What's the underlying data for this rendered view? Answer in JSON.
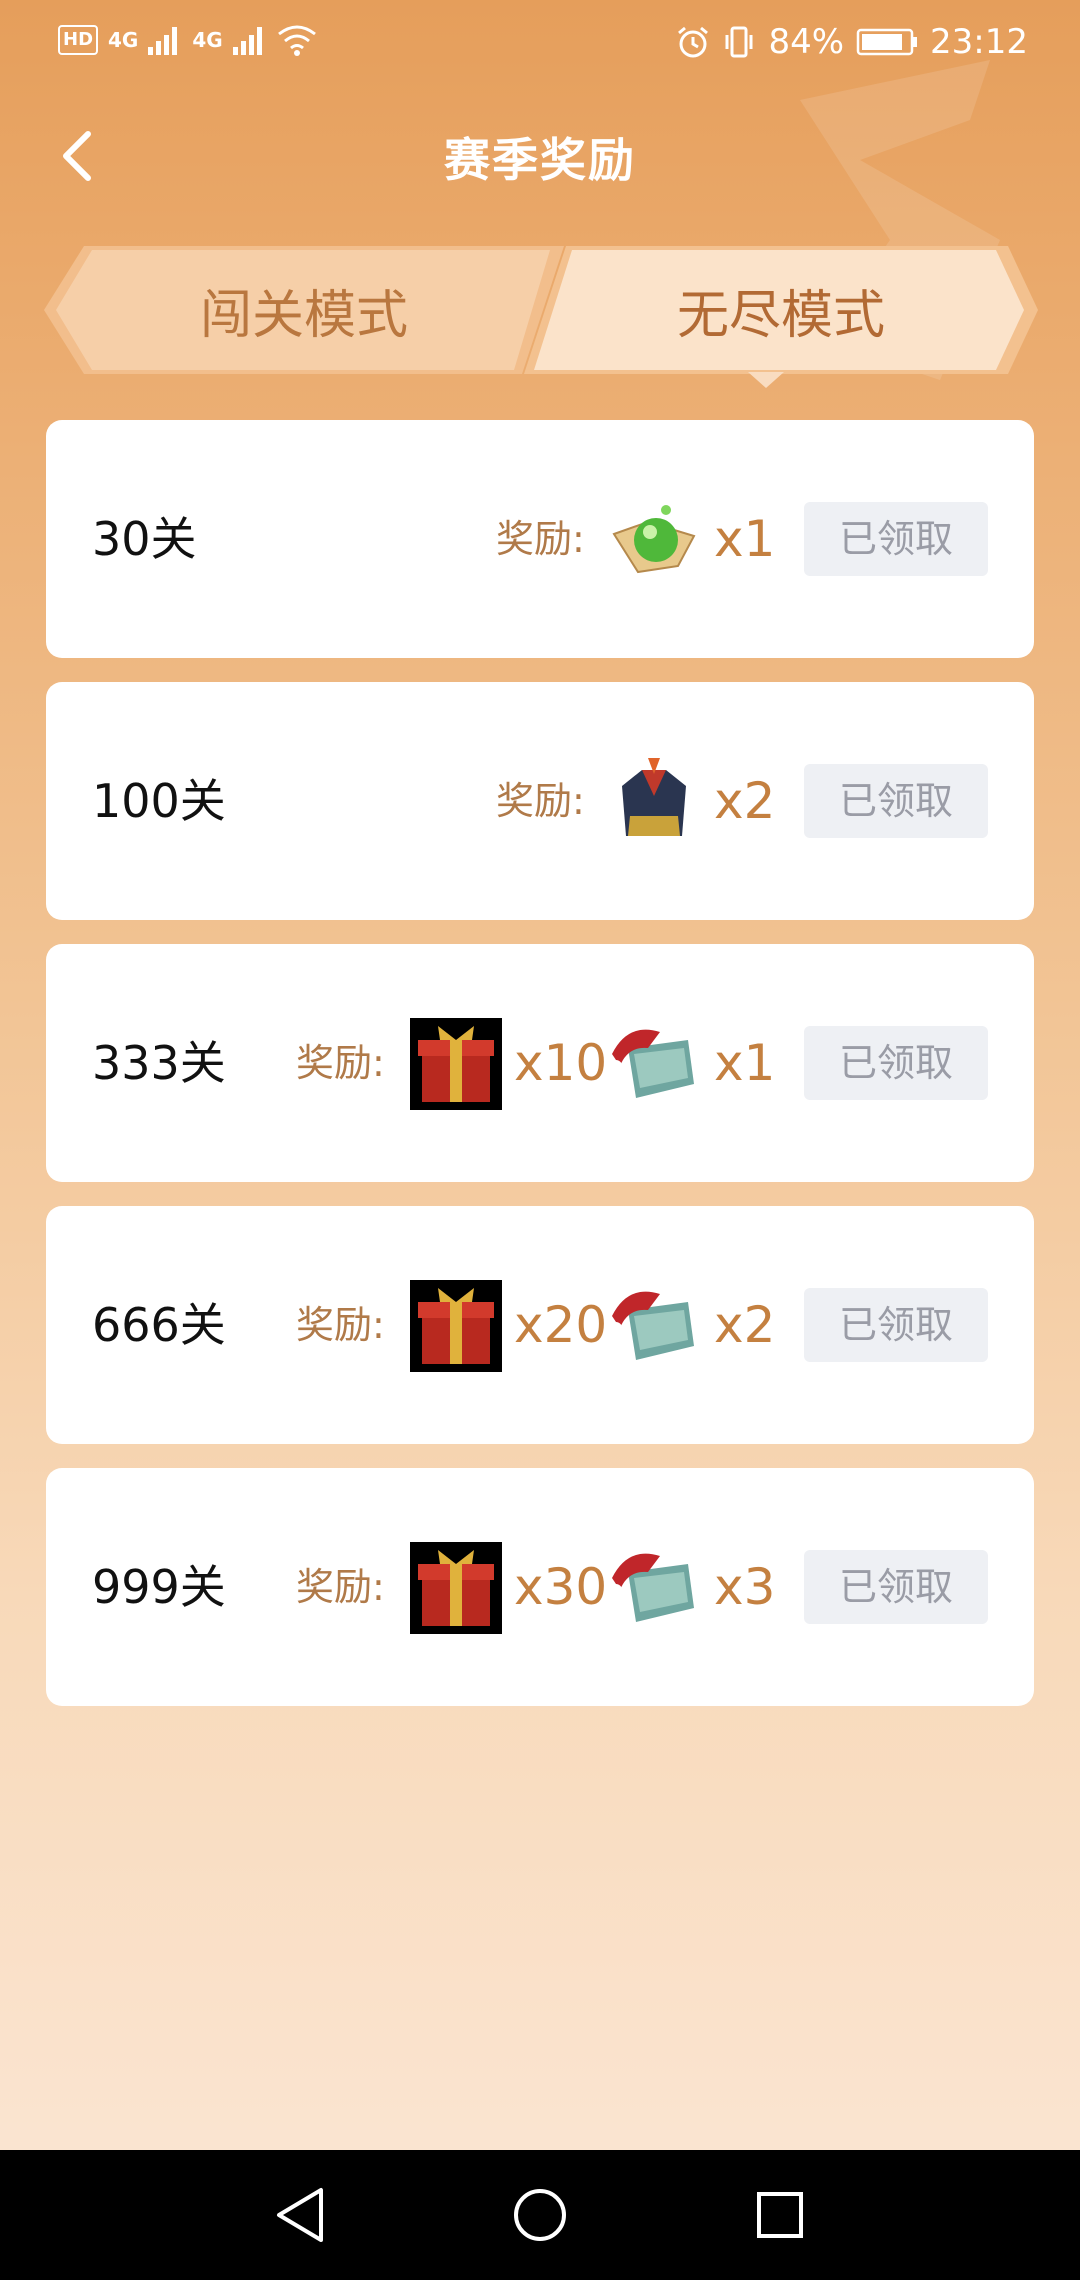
{
  "status_bar": {
    "hd": "HD",
    "net1": "4G",
    "net2": "4G",
    "battery": "84%",
    "time": "23:12"
  },
  "header": {
    "title": "赛季奖励"
  },
  "tabs": [
    {
      "label": "闯关模式",
      "active": false
    },
    {
      "label": "无尽模式",
      "active": true
    }
  ],
  "reward_label": "奖励:",
  "rows": [
    {
      "level": "30关",
      "rewards": [
        {
          "icon": "green-orb-icon",
          "qty": "x1"
        }
      ],
      "button": "已领取"
    },
    {
      "level": "100关",
      "rewards": [
        {
          "icon": "armor-icon",
          "qty": "x2"
        }
      ],
      "button": "已领取"
    },
    {
      "level": "333关",
      "rewards": [
        {
          "icon": "gift-box-icon",
          "qty": "x10"
        },
        {
          "icon": "banknote-icon",
          "qty": "x1"
        }
      ],
      "button": "已领取"
    },
    {
      "level": "666关",
      "rewards": [
        {
          "icon": "gift-box-icon",
          "qty": "x20"
        },
        {
          "icon": "banknote-icon",
          "qty": "x2"
        }
      ],
      "button": "已领取"
    },
    {
      "level": "999关",
      "rewards": [
        {
          "icon": "gift-box-icon",
          "qty": "x30"
        },
        {
          "icon": "banknote-icon",
          "qty": "x3"
        }
      ],
      "button": "已领取"
    }
  ],
  "colors": {
    "accent": "#b26a34",
    "reward_label": "#b07a49",
    "quantity": "#c48040",
    "claimed_button_bg": "#eef0f4",
    "claimed_button_text": "#9a9ca6"
  }
}
